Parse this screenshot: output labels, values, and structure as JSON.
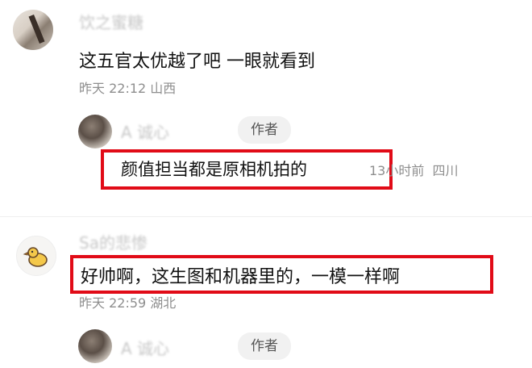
{
  "comment1": {
    "username": "饮之蜜糖",
    "text": "这五官太优越了吧 一眼就看到",
    "time": "昨天 22:12",
    "location": "山西",
    "reply": {
      "username": "A 诚心",
      "badge": "作者",
      "text": "颜值担当都是原相机拍的",
      "time": "13小时前",
      "location": "四川"
    }
  },
  "comment2": {
    "username": "Sa的悲惨",
    "text": "好帅啊，这生图和机器里的，一模一样啊",
    "time": "昨天 22:59",
    "location": "湖北",
    "reply": {
      "username": "A 诚心",
      "badge": "作者"
    }
  },
  "colors": {
    "highlight": "#e10b17",
    "meta": "#8e8e8e",
    "badge_bg": "#f1f1f1"
  }
}
